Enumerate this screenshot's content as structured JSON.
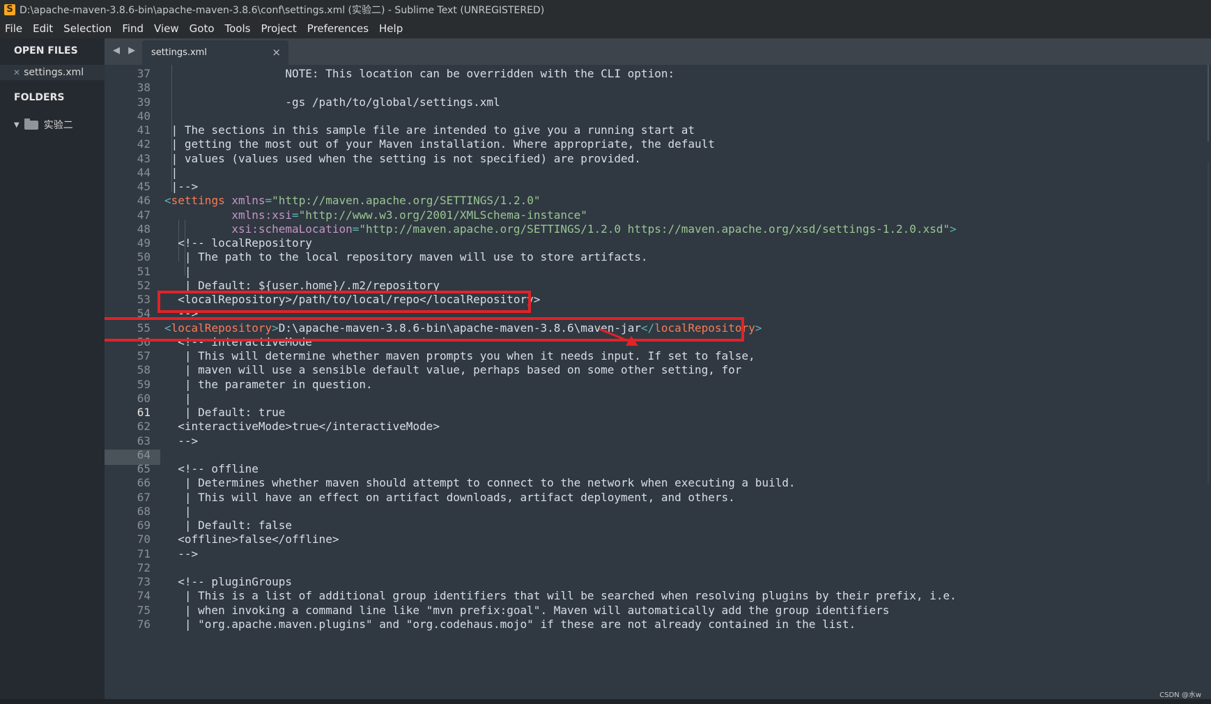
{
  "window": {
    "title": "D:\\apache-maven-3.8.6-bin\\apache-maven-3.8.6\\conf\\settings.xml (实验二) - Sublime Text (UNREGISTERED)",
    "app_icon": "S"
  },
  "menu": [
    "File",
    "Edit",
    "Selection",
    "Find",
    "View",
    "Goto",
    "Tools",
    "Project",
    "Preferences",
    "Help"
  ],
  "sidebar": {
    "open_files_header": "OPEN FILES",
    "open_file": "settings.xml",
    "folders_header": "FOLDERS",
    "folder": "实验二"
  },
  "tabs": {
    "nav": "◀ ▶",
    "active": "settings.xml",
    "close": "×"
  },
  "editor": {
    "current_line": 61,
    "lines": [
      {
        "n": 37,
        "tokens": [
          {
            "t": "                  NOTE: This location can be overridden with the CLI option:"
          }
        ]
      },
      {
        "n": 38,
        "tokens": []
      },
      {
        "n": 39,
        "tokens": [
          {
            "t": "                  -gs /path/to/global/settings.xml"
          }
        ]
      },
      {
        "n": 40,
        "tokens": []
      },
      {
        "n": 41,
        "tokens": [
          {
            "t": " | The sections in this sample file are intended to give you a running start at"
          }
        ]
      },
      {
        "n": 42,
        "tokens": [
          {
            "t": " | getting the most out of your Maven installation. Where appropriate, the default"
          }
        ]
      },
      {
        "n": 43,
        "tokens": [
          {
            "t": " | values (values used when the setting is not specified) are provided."
          }
        ]
      },
      {
        "n": 44,
        "tokens": [
          {
            "t": " |"
          }
        ]
      },
      {
        "n": 45,
        "tokens": [
          {
            "t": " |-->"
          }
        ]
      },
      {
        "n": 46,
        "tokens": [
          {
            "t": "<",
            "c": "pu"
          },
          {
            "t": "settings",
            "c": "tg"
          },
          {
            "t": " "
          },
          {
            "t": "xmlns",
            "c": "at"
          },
          {
            "t": "=",
            "c": "pu"
          },
          {
            "t": "\"http://maven.apache.org/SETTINGS/1.2.0\"",
            "c": "st"
          }
        ]
      },
      {
        "n": 47,
        "tokens": [
          {
            "t": "          "
          },
          {
            "t": "xmlns:xsi",
            "c": "at"
          },
          {
            "t": "=",
            "c": "pu"
          },
          {
            "t": "\"http://www.w3.org/2001/XMLSchema-instance\"",
            "c": "st"
          }
        ]
      },
      {
        "n": 48,
        "tokens": [
          {
            "t": "          "
          },
          {
            "t": "xsi:schemaLocation",
            "c": "at"
          },
          {
            "t": "=",
            "c": "pu"
          },
          {
            "t": "\"http://maven.apache.org/SETTINGS/1.2.0 https://maven.apache.org/xsd/settings-1.2.0.xsd\"",
            "c": "st"
          },
          {
            "t": ">",
            "c": "pu"
          }
        ]
      },
      {
        "n": 49,
        "tokens": [
          {
            "t": "  <!-- localRepository"
          }
        ]
      },
      {
        "n": 50,
        "tokens": [
          {
            "t": "   | The path to the local repository maven will use to store artifacts."
          }
        ]
      },
      {
        "n": 51,
        "tokens": [
          {
            "t": "   |"
          }
        ]
      },
      {
        "n": 52,
        "tokens": [
          {
            "t": "   | Default: ${user.home}/.m2/repository"
          }
        ]
      },
      {
        "n": 53,
        "tokens": [
          {
            "t": "  <localRepository>/path/to/local/repo</localRepository>"
          }
        ]
      },
      {
        "n": 54,
        "tokens": [
          {
            "t": "  -->"
          }
        ]
      },
      {
        "n": 55,
        "tokens": [
          {
            "t": "<",
            "c": "pu"
          },
          {
            "t": "localRepository",
            "c": "tg"
          },
          {
            "t": ">",
            "c": "pu"
          },
          {
            "t": "D:\\apache-maven-3.8.6-bin\\apache-maven-3.8.6\\maven-jar"
          },
          {
            "t": "</",
            "c": "pu"
          },
          {
            "t": "localRepository",
            "c": "tg"
          },
          {
            "t": ">",
            "c": "pu"
          }
        ]
      },
      {
        "n": 56,
        "tokens": [
          {
            "t": "  <!-- interactiveMode"
          }
        ]
      },
      {
        "n": 57,
        "tokens": [
          {
            "t": "   | This will determine whether maven prompts you when it needs input. If set to false,"
          }
        ]
      },
      {
        "n": 58,
        "tokens": [
          {
            "t": "   | maven will use a sensible default value, perhaps based on some other setting, for"
          }
        ]
      },
      {
        "n": 59,
        "tokens": [
          {
            "t": "   | the parameter in question."
          }
        ]
      },
      {
        "n": 60,
        "tokens": [
          {
            "t": "   |"
          }
        ]
      },
      {
        "n": 61,
        "tokens": [
          {
            "t": "   | Default: true"
          }
        ]
      },
      {
        "n": 62,
        "tokens": [
          {
            "t": "  <interactiveMode>true</interactiveMode>"
          }
        ]
      },
      {
        "n": 63,
        "tokens": [
          {
            "t": "  -->"
          }
        ]
      },
      {
        "n": 64,
        "tokens": []
      },
      {
        "n": 65,
        "tokens": [
          {
            "t": "  <!-- offline"
          }
        ]
      },
      {
        "n": 66,
        "tokens": [
          {
            "t": "   | Determines whether maven should attempt to connect to the network when executing a build."
          }
        ]
      },
      {
        "n": 67,
        "tokens": [
          {
            "t": "   | This will have an effect on artifact downloads, artifact deployment, and others."
          }
        ]
      },
      {
        "n": 68,
        "tokens": [
          {
            "t": "   |"
          }
        ]
      },
      {
        "n": 69,
        "tokens": [
          {
            "t": "   | Default: false"
          }
        ]
      },
      {
        "n": 70,
        "tokens": [
          {
            "t": "  <offline>false</offline>"
          }
        ]
      },
      {
        "n": 71,
        "tokens": [
          {
            "t": "  -->"
          }
        ]
      },
      {
        "n": 72,
        "tokens": []
      },
      {
        "n": 73,
        "tokens": [
          {
            "t": "  <!-- pluginGroups"
          }
        ]
      },
      {
        "n": 74,
        "tokens": [
          {
            "t": "   | This is a list of additional group identifiers that will be searched when resolving plugins by their prefix, i.e."
          }
        ]
      },
      {
        "n": 75,
        "tokens": [
          {
            "t": "   | when invoking a command line like \"mvn prefix:goal\". Maven will automatically add the group identifiers"
          }
        ]
      },
      {
        "n": 76,
        "tokens": [
          {
            "t": "   | \"org.apache.maven.plugins\" and \"org.codehaus.mojo\" if these are not already contained in the list."
          }
        ]
      }
    ]
  },
  "annotations": {
    "highlight_color": "#e32226"
  },
  "watermark": "CSDN @水w"
}
